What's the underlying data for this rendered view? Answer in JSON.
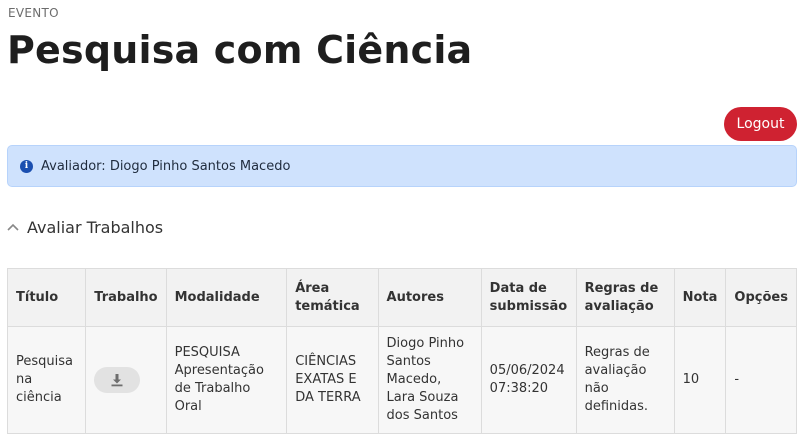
{
  "header": {
    "eyebrow": "EVENTO",
    "title": "Pesquisa com Ciência"
  },
  "actions": {
    "logout_label": "Logout"
  },
  "alert": {
    "icon": "info-circle-icon",
    "text": "Avaliador: Diogo Pinho Santos Macedo"
  },
  "section": {
    "title": "Avaliar Trabalhos",
    "icon": "chevron-up-icon"
  },
  "table": {
    "columns": [
      "Título",
      "Trabalho",
      "Modalidade",
      "Área temática",
      "Autores",
      "Data de submissão",
      "Regras de avaliação",
      "Nota",
      "Opções"
    ],
    "rows": [
      {
        "titulo": "Pesquisa na ciência",
        "trabalho_icon": "download-icon",
        "modalidade": "PESQUISA Apresentação de Trabalho Oral",
        "area": "CIÊNCIAS EXATAS E DA TERRA",
        "autores": "Diogo Pinho Santos Macedo, Lara Souza dos Santos",
        "data": "05/06/2024 07:38:20",
        "regras": "Regras de avaliação não definidas.",
        "nota": "10",
        "opcoes": "-"
      }
    ]
  },
  "colors": {
    "logout_bg": "#cf2231",
    "alert_bg": "#cfe2fd",
    "alert_icon": "#1b4fb0"
  }
}
